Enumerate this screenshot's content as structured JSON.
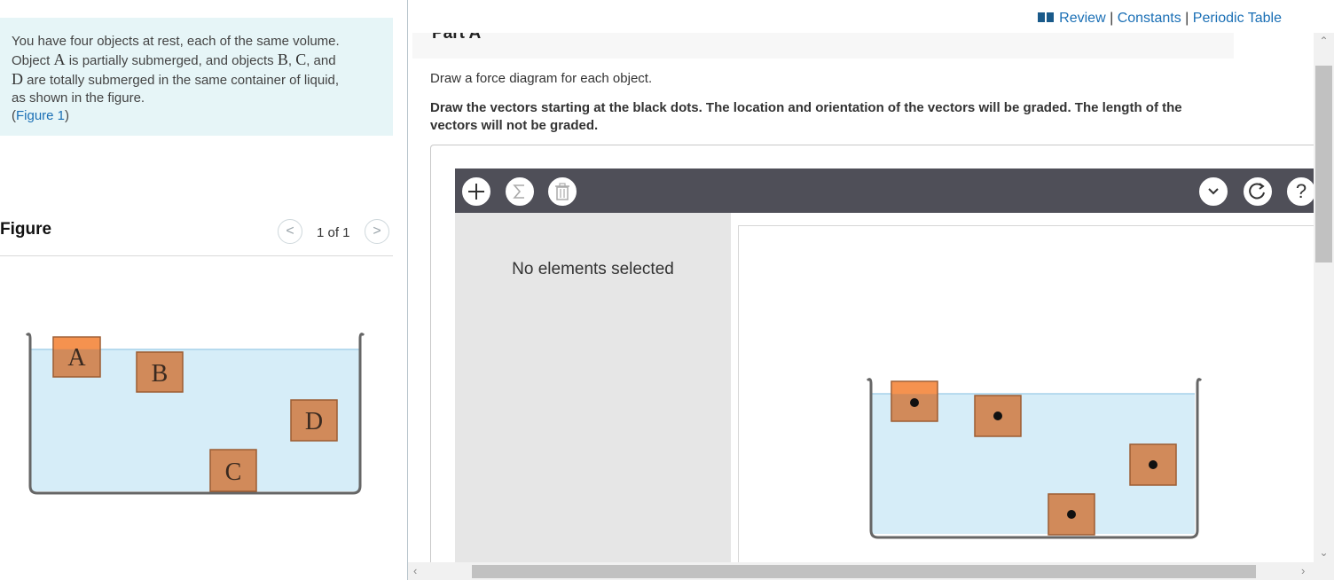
{
  "problem": {
    "line1": "You have four objects at rest, each of the same volume.",
    "obj_a_prefix": "Object ",
    "obj_a": "A",
    "obj_a_mid": " is partially submerged, and objects ",
    "obj_b": "B",
    "comma1": ", ",
    "obj_c": "C",
    "and_word": ", and",
    "obj_d": "D",
    "line3_rest": " are totally submerged in the same container of liquid,",
    "line4": "as shown in the figure.",
    "figure_link_open": "(",
    "figure_link": "Figure 1",
    "figure_link_close": ")"
  },
  "figure_panel": {
    "title": "Figure",
    "prev": "<",
    "next": ">",
    "pager": "1 of 1",
    "labels": {
      "a": "A",
      "b": "B",
      "c": "C",
      "d": "D"
    }
  },
  "header": {
    "review": "Review",
    "sep1": " | ",
    "constants": "Constants",
    "sep2": " | ",
    "periodic_table": "Periodic Table"
  },
  "part": {
    "title": "Part A",
    "instruction": "Draw a force diagram for each object.",
    "bold_instruction": "Draw the vectors starting at the black dots. The location and orientation of the vectors will be graded. The length of the vectors will not be graded."
  },
  "tool": {
    "no_selection": "No elements selected",
    "help": "?",
    "icons": [
      "plus-icon",
      "sigma-icon",
      "trash-icon",
      "chevron-down-icon",
      "reset-icon",
      "help-icon"
    ]
  },
  "colors": {
    "liquid": "#d6edf8",
    "block": "#d18a5a",
    "block_above": "#f5924f",
    "toolbar": "#4f4f58",
    "link": "#1a6fb5",
    "problem_bg": "#e6f5f7"
  }
}
